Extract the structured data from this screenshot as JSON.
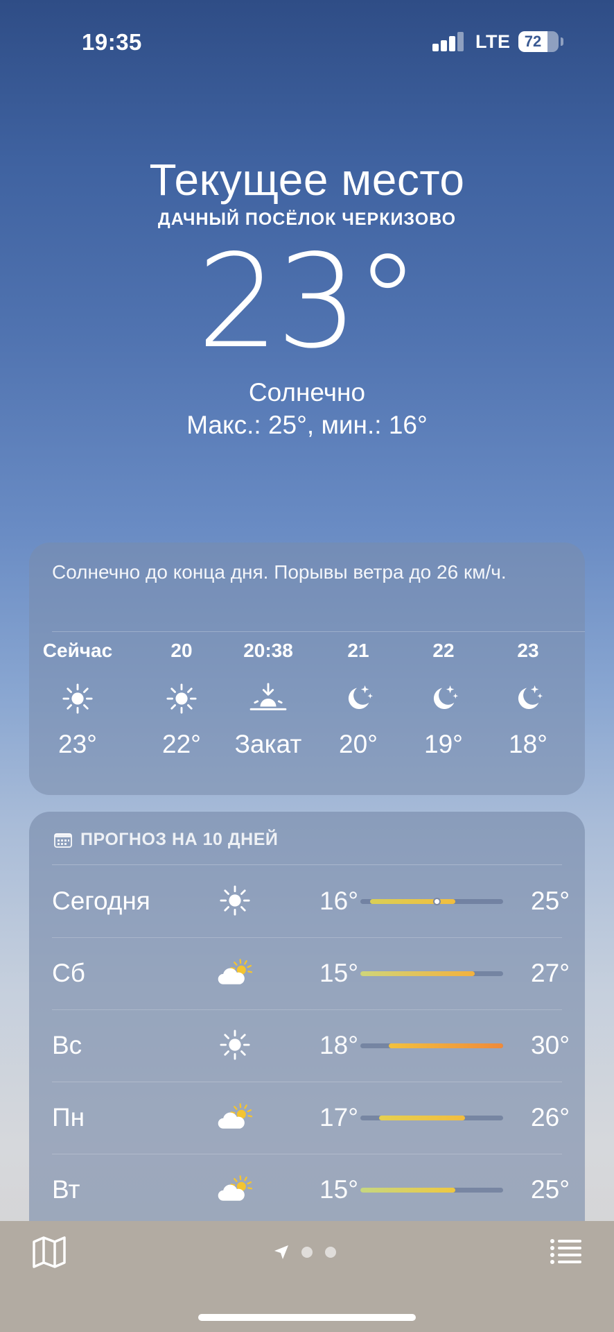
{
  "status": {
    "time": "19:35",
    "network": "LTE",
    "battery": "72",
    "battery_fraction": 0.72
  },
  "location": {
    "title": "Текущее место",
    "subtitle": "ДАЧНЫЙ ПОСЁЛОК ЧЕРКИЗОВО"
  },
  "current": {
    "temp": "23°",
    "condition": "Солнечно",
    "minmax": "Макс.: 25°, мин.: 16°"
  },
  "hourly": {
    "summary": "Солнечно до конца дня. Порывы ветра до 26 км/ч.",
    "items": [
      {
        "time": "Сейчас",
        "icon": "sun-icon",
        "temp": "23°"
      },
      {
        "time": "20",
        "icon": "sun-icon",
        "temp": "22°"
      },
      {
        "time": "20:38",
        "icon": "sunset-icon",
        "temp": "Закат"
      },
      {
        "time": "21",
        "icon": "moon-stars-icon",
        "temp": "20°"
      },
      {
        "time": "22",
        "icon": "moon-stars-icon",
        "temp": "19°"
      },
      {
        "time": "23",
        "icon": "moon-stars-icon",
        "temp": "18°"
      }
    ]
  },
  "daily": {
    "header": "ПРОГНОЗ НА 10 ДНЕЙ",
    "range": [
      15,
      30
    ],
    "current_temp": 23,
    "days": [
      {
        "name": "Сегодня",
        "icon": "sun-icon",
        "min": "16°",
        "max": "25°",
        "lo": 16,
        "hi": 25,
        "colors": [
          "#d9cf56",
          "#f2be3e"
        ],
        "current": true
      },
      {
        "name": "Сб",
        "icon": "partly-cloudy-icon",
        "min": "15°",
        "max": "27°",
        "lo": 15,
        "hi": 27,
        "colors": [
          "#cfd57a",
          "#f3b13d"
        ]
      },
      {
        "name": "Вс",
        "icon": "sun-icon",
        "min": "18°",
        "max": "30°",
        "lo": 18,
        "hi": 30,
        "colors": [
          "#f2c13e",
          "#ef8a3a"
        ]
      },
      {
        "name": "Пн",
        "icon": "partly-cloudy-icon",
        "min": "17°",
        "max": "26°",
        "lo": 17,
        "hi": 26,
        "colors": [
          "#e5d051",
          "#f2bd3f"
        ]
      },
      {
        "name": "Вт",
        "icon": "partly-cloudy-icon",
        "min": "15°",
        "max": "25°",
        "lo": 15,
        "hi": 25,
        "colors": [
          "#c6d781",
          "#efc840"
        ]
      }
    ]
  },
  "toolbar": {
    "page_count": 2
  }
}
